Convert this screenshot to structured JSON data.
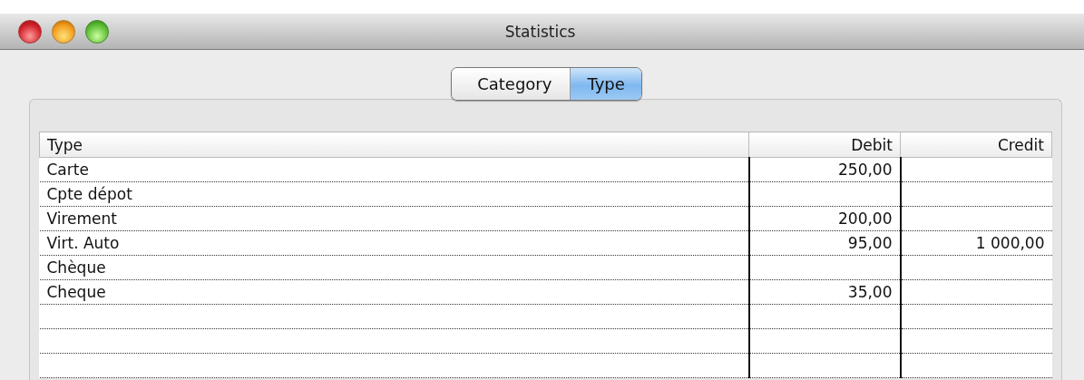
{
  "window": {
    "title": "Statistics"
  },
  "tabs": [
    {
      "label": "Category",
      "selected": false
    },
    {
      "label": "Type",
      "selected": true
    }
  ],
  "table": {
    "columns": [
      "Type",
      "Debit",
      "Credit"
    ],
    "rows": [
      [
        "Carte",
        "250,00",
        ""
      ],
      [
        "Cpte dépot",
        "",
        ""
      ],
      [
        "Virement",
        "200,00",
        ""
      ],
      [
        "Virt. Auto",
        "95,00",
        "1 000,00"
      ],
      [
        "Chèque",
        "",
        ""
      ],
      [
        "Cheque",
        "35,00",
        ""
      ]
    ]
  }
}
